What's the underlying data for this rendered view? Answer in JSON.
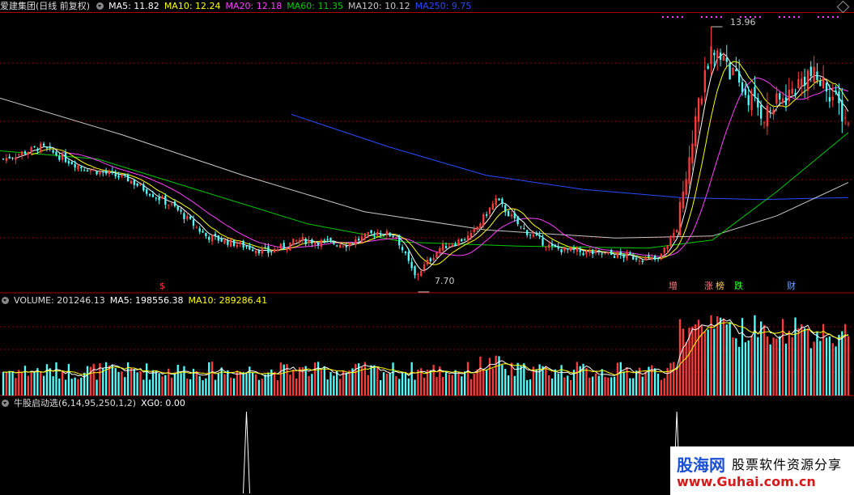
{
  "price_panel": {
    "stock_name": "爱建集团(日线 前复权)",
    "ma5": "MA5: 11.82",
    "ma10": "MA10: 12.24",
    "ma20": "MA20: 12.18",
    "ma60": "MA60: 11.35",
    "ma120": "MA120: 10.12",
    "ma250": "MA250: 9.75",
    "high_label": "13.96",
    "low_label": "7.70",
    "events": [
      "$",
      "增",
      "涨",
      "榜",
      "跌",
      "财"
    ]
  },
  "volume_panel": {
    "volume": "VOLUME: 201246.13",
    "ma5": "MA5: 198556.38",
    "ma10": "MA10: 289286.41"
  },
  "indicator_panel": {
    "title": "牛股启动选(6,14,95,250,1,2)",
    "xg": "XG0: 0.00"
  },
  "watermark": {
    "brand": "股海网",
    "slogan": "股票软件资源分享",
    "url": "www.Guhai.com.cn"
  },
  "colors": {
    "up": "#ff3c3c",
    "down": "#54ffff",
    "ma5": "#ffffff",
    "ma10": "#ffff00",
    "ma20": "#ff40ff",
    "ma60": "#00cc00",
    "ma120": "#c8c8c8",
    "ma250": "#2a4bff",
    "grid": "#8b0000"
  },
  "chart_data": {
    "type": "candlestick",
    "x": "trading day index",
    "price_range": [
      7.4,
      14.3
    ],
    "price_anchors": [
      {
        "day": 0,
        "close": 10.7
      },
      {
        "day": 12,
        "close": 11.0
      },
      {
        "day": 25,
        "close": 10.5
      },
      {
        "day": 40,
        "close": 10.2
      },
      {
        "day": 55,
        "close": 9.5
      },
      {
        "day": 65,
        "close": 8.8
      },
      {
        "day": 75,
        "close": 8.6
      },
      {
        "day": 85,
        "close": 8.4
      },
      {
        "day": 95,
        "close": 8.7
      },
      {
        "day": 110,
        "close": 8.6
      },
      {
        "day": 120,
        "close": 8.9
      },
      {
        "day": 126,
        "close": 8.8
      },
      {
        "day": 132,
        "close": 7.8
      },
      {
        "day": 140,
        "close": 8.5
      },
      {
        "day": 150,
        "close": 8.8
      },
      {
        "day": 158,
        "close": 9.7
      },
      {
        "day": 166,
        "close": 9.0
      },
      {
        "day": 176,
        "close": 8.5
      },
      {
        "day": 186,
        "close": 8.4
      },
      {
        "day": 200,
        "close": 8.3
      },
      {
        "day": 210,
        "close": 8.2
      },
      {
        "day": 216,
        "close": 9.0
      },
      {
        "day": 222,
        "close": 11.8
      },
      {
        "day": 228,
        "close": 13.5
      },
      {
        "day": 236,
        "close": 12.5
      },
      {
        "day": 244,
        "close": 11.8
      },
      {
        "day": 252,
        "close": 12.3
      },
      {
        "day": 258,
        "close": 12.8
      },
      {
        "day": 264,
        "close": 12.5
      },
      {
        "day": 270,
        "close": 11.7
      }
    ],
    "high": 13.96,
    "low": 7.7,
    "last_ma": {
      "MA5": 11.82,
      "MA10": 12.24,
      "MA20": 12.18,
      "MA60": 11.35,
      "MA120": 10.12,
      "MA250": 9.75
    },
    "volume_last": {
      "VOLUME": 201246.13,
      "MA5": 198556.38,
      "MA10": 289286.41
    },
    "signal_days": [
      78,
      216
    ],
    "xg_last": 0
  }
}
